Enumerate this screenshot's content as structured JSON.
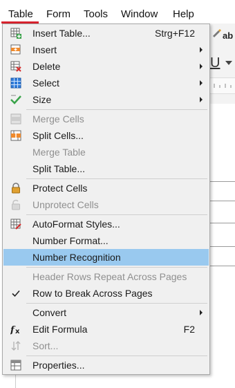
{
  "menubar": {
    "items": [
      "Table",
      "Form",
      "Tools",
      "Window",
      "Help"
    ]
  },
  "table_menu": {
    "items": [
      {
        "label": "Insert Table...",
        "shortcut": "Strg+F12"
      },
      {
        "label": "Insert"
      },
      {
        "label": "Delete"
      },
      {
        "label": "Select"
      },
      {
        "label": "Size"
      },
      {
        "label": "Merge Cells"
      },
      {
        "label": "Split Cells..."
      },
      {
        "label": "Merge Table"
      },
      {
        "label": "Split Table..."
      },
      {
        "label": "Protect Cells"
      },
      {
        "label": "Unprotect Cells"
      },
      {
        "label": "AutoFormat Styles..."
      },
      {
        "label": "Number Format..."
      },
      {
        "label": "Number Recognition"
      },
      {
        "label": "Header Rows Repeat Across Pages"
      },
      {
        "label": "Row to Break Across Pages"
      },
      {
        "label": "Convert"
      },
      {
        "label": "Edit Formula",
        "shortcut": "F2"
      },
      {
        "label": "Sort..."
      },
      {
        "label": "Properties..."
      }
    ]
  },
  "colors": {
    "highlight": "#99c9ef",
    "menu_bg": "#f0f0f0",
    "active_underline": "#d9232e",
    "disabled_text": "#8f8f8f"
  },
  "icons": {
    "insert_table": "table-grid-plus-icon",
    "insert": "insert-rows-icon",
    "delete": "delete-rows-icon",
    "select": "select-table-icon",
    "size": "optimal-size-checkmark-icon",
    "merge_cells": "merge-cells-icon",
    "split_cells": "split-cells-icon",
    "protect": "lock-icon",
    "unprotect": "unlock-icon",
    "autoformat": "autoformat-icon",
    "row_break_check": "checkmark-icon",
    "formula": "fx-icon",
    "sort": "sort-arrows-icon",
    "properties": "table-properties-icon"
  }
}
